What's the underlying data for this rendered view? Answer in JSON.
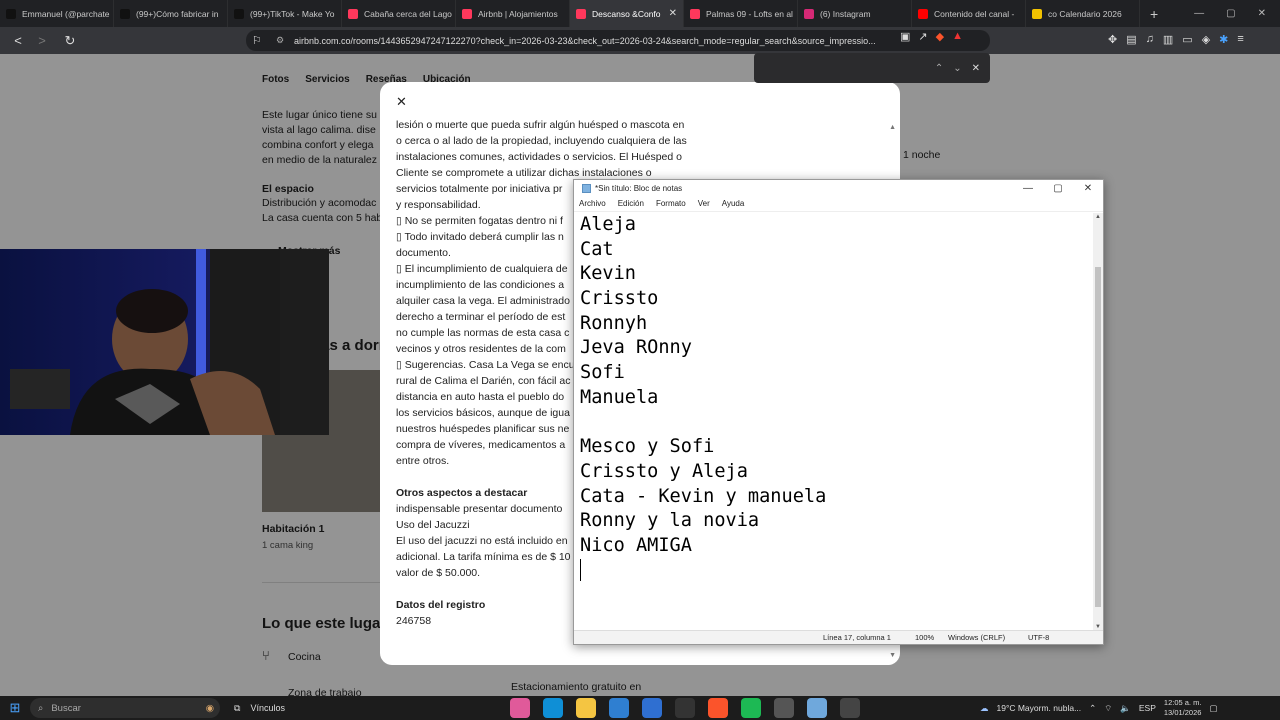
{
  "tabs": [
    {
      "label": "Emmanuel (@parchate",
      "color": "#111111",
      "icon": "tiktok-icon"
    },
    {
      "label": "(99+)Cómo fabricar in",
      "color": "#111111",
      "icon": "tiktok-icon"
    },
    {
      "label": "(99+)TikTok - Make Yo",
      "color": "#111111",
      "icon": "tiktok-icon"
    },
    {
      "label": "Cabaña cerca del Lago",
      "color": "#ff385c",
      "icon": "airbnb-icon"
    },
    {
      "label": "Airbnb | Alojamientos",
      "color": "#ff385c",
      "icon": "airbnb-icon"
    },
    {
      "label": "Descanso &Confo",
      "color": "#ff385c",
      "icon": "airbnb-icon",
      "active": true
    },
    {
      "label": "Palmas 09 - Lofts en al",
      "color": "#ff385c",
      "icon": "airbnb-icon"
    },
    {
      "label": "(6) Instagram",
      "color": "#d62976",
      "icon": "instagram-icon"
    },
    {
      "label": "Contenido del canal -",
      "color": "#ff0000",
      "icon": "youtube-icon"
    },
    {
      "label": "co Calendario 2026",
      "color": "#f2c200",
      "icon": "calendar-icon"
    }
  ],
  "browser": {
    "url": "airbnb.com.co/rooms/1443652947247122270?check_in=2026-03-23&check_out=2026-03-24&search_mode=regular_search&source_impressio...",
    "new_tab": "+",
    "back": "<",
    "forward": ">",
    "reload": "↻",
    "minimize": "—",
    "maximize": "▢",
    "close": "✕"
  },
  "findbar": {
    "up": "⌃",
    "down": "⌄",
    "close": "✕"
  },
  "page": {
    "subnav": [
      "Fotos",
      "Servicios",
      "Reseñas",
      "Ubicación"
    ],
    "left_lines": [
      "Este lugar único tiene su",
      "vista al lago calima. dise",
      "combina confort y elega",
      "en medio de la naturalez"
    ],
    "espacio_title": "El espacio",
    "espacio_lines": [
      "Distribución y acomodac",
      "La casa cuenta con 5 hab"
    ],
    "mostrar_mas": "Mostrar más",
    "dormir_title": "Dónde vas a dormir",
    "habitacion": "Habitación 1",
    "cama": "1 cama king",
    "lugar_title": "Lo que este lugar o",
    "cocina": "Cocina",
    "zona": "Zona de trabajo",
    "noche": "1 noche",
    "estacionamiento": "Estacionamiento gratuito en"
  },
  "modal": {
    "close": "✕",
    "lines": [
      "lesión o muerte que pueda sufrir algún huésped o mascota en",
      "o cerca o al lado de la propiedad, incluyendo cualquiera de las",
      "instalaciones comunes, actividades o servicios. El Huésped o",
      "Cliente se compromete a utilizar dichas instalaciones o",
      "servicios totalmente por iniciativa pr",
      "y responsabilidad.",
      "▯ No se permiten fogatas dentro ni f",
      "▯ Todo invitado deberá cumplir las n",
      "documento.",
      "▯ El incumplimiento de cualquiera de",
      "incumplimiento de las condiciones a",
      "alquiler casa la vega. El administrado",
      "derecho a terminar el período de est",
      "no cumple las normas de esta casa c",
      "vecinos y otros residentes de la com",
      "▯ Sugerencias. Casa La Vega se encu",
      "rural de Calima el Darién, con fácil ac",
      "distancia en auto hasta el pueblo do",
      "los servicios básicos, aunque de igua",
      "nuestros huéspedes planificar sus ne",
      "compra de víveres, medicamentos a",
      "entre otros."
    ],
    "otros_title": "Otros aspectos a destacar",
    "otros_lines": [
      "indispensable presentar documento",
      "Uso del Jacuzzi",
      "El uso del jacuzzi no está incluido en",
      "adicional. La tarifa mínima es de $ 10",
      "valor de $ 50.000."
    ],
    "registro_title": "Datos del registro",
    "registro_value": "246758"
  },
  "notepad": {
    "title": "*Sin título: Bloc de notas",
    "menu": [
      "Archivo",
      "Edición",
      "Formato",
      "Ver",
      "Ayuda"
    ],
    "lines": [
      "Aleja",
      "Cat",
      "Kevin",
      "Crissto",
      "Ronnyh",
      "Jeva ROnny",
      "Sofi",
      "Manuela",
      "",
      "Mesco y Sofi",
      "Crissto y Aleja",
      "Cata - Kevin y manuela",
      "Ronny y la novia",
      "Nico AMIGA"
    ],
    "status": {
      "position": "Línea 17, columna 1",
      "zoom": "100%",
      "eol": "Windows (CRLF)",
      "encoding": "UTF-8"
    }
  },
  "taskbar": {
    "search": "Buscar",
    "vinculos": "Vínculos",
    "weather": "19°C  Mayorm. nubla...",
    "lang": "ESP",
    "time": "12:05 a. m.",
    "date": "13/01/2026",
    "apps": [
      {
        "name": "colorful-app-icon",
        "color": "#e05a9a"
      },
      {
        "name": "edge-icon",
        "color": "#0f8fd6"
      },
      {
        "name": "file-explorer-icon",
        "color": "#f4c542"
      },
      {
        "name": "store-icon",
        "color": "#2f7fd1"
      },
      {
        "name": "mail-icon",
        "color": "#2f6fd1"
      },
      {
        "name": "obs-icon",
        "color": "#333333"
      },
      {
        "name": "brave-icon",
        "color": "#fb542b"
      },
      {
        "name": "spotify-icon",
        "color": "#1db954"
      },
      {
        "name": "settings-icon",
        "color": "#555555"
      },
      {
        "name": "notepad-icon",
        "color": "#6fa8dc"
      },
      {
        "name": "calculator-icon",
        "color": "#444444"
      }
    ]
  }
}
